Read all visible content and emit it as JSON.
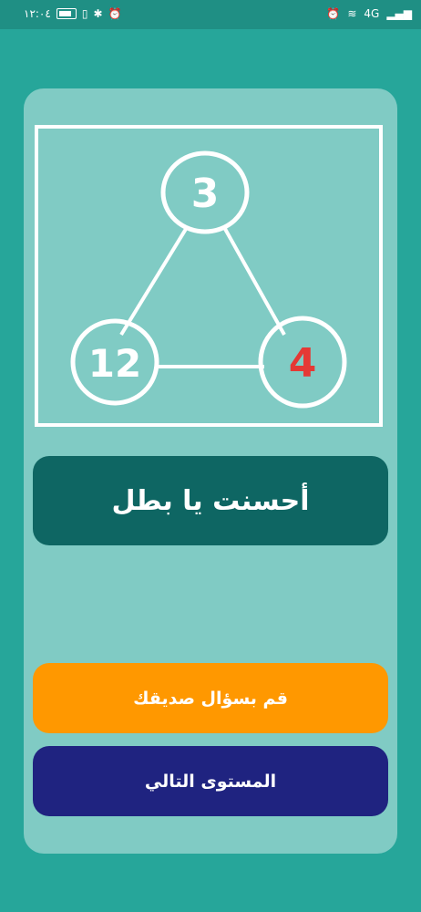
{
  "status_bar": {
    "time": "١٢:٠٤",
    "network_right": "4G",
    "signal_label": "4G"
  },
  "puzzle": {
    "top_value": "3",
    "left_value": "12",
    "right_value": "4",
    "highlight_color": "#e53935",
    "line_color": "#ffffff"
  },
  "message": {
    "text": "أحسنت يا بطل"
  },
  "buttons": {
    "ask_friend": "قم بسؤال صديقك",
    "next_level": "المستوى التالي"
  },
  "colors": {
    "background": "#26a69a",
    "card": "#80cbc4",
    "message_bg": "#0e6663",
    "ask_btn": "#ff9800",
    "next_btn": "#1f2380"
  }
}
